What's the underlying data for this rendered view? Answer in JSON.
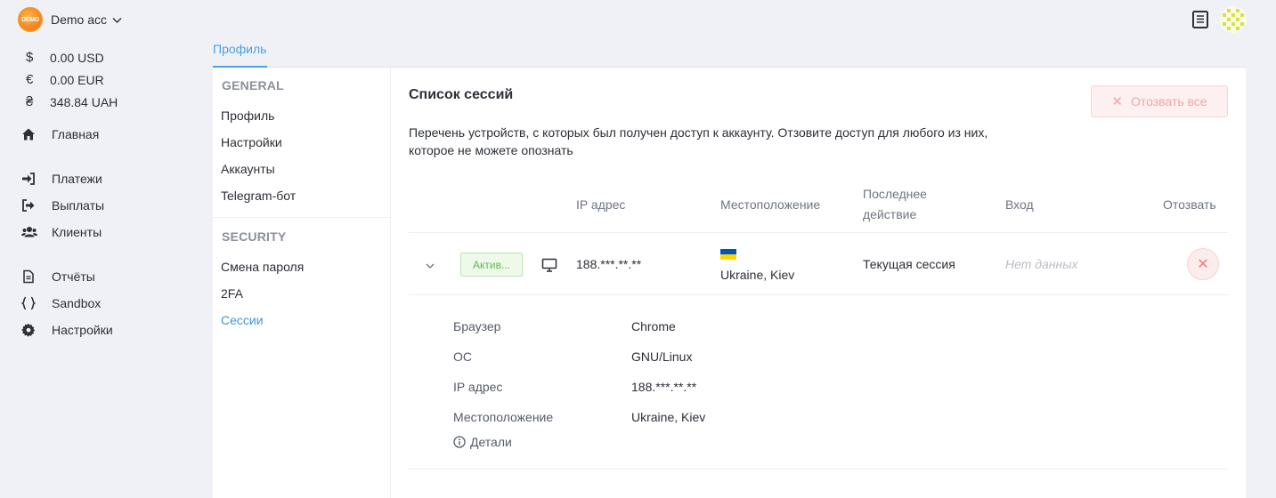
{
  "account": {
    "logo_text": "DEMO",
    "name": "Demo acc"
  },
  "balances": [
    {
      "symbol": "$",
      "amount": "0.00 USD"
    },
    {
      "symbol": "€",
      "amount": "0.00 EUR"
    },
    {
      "symbol": "₴",
      "amount": "348.84 UAH"
    }
  ],
  "nav": {
    "home": "Главная",
    "payments": "Платежи",
    "payouts": "Выплаты",
    "clients": "Клиенты",
    "reports": "Отчёты",
    "sandbox": "Sandbox",
    "settings": "Настройки"
  },
  "tabs": {
    "profile": "Профиль"
  },
  "subnav": {
    "general_title": "GENERAL",
    "profile": "Профиль",
    "settings": "Настройки",
    "accounts": "Аккаунты",
    "telegram": "Telegram-бот",
    "security_title": "SECURITY",
    "change_password": "Смена пароля",
    "twofa": "2FA",
    "sessions": "Сессии"
  },
  "sessions": {
    "title": "Список сессий",
    "revoke_all": "Отозвать все",
    "description_line1": "Перечень устройств, с которых был получен доступ к аккаунту. Отзовите доступ для любого из них,",
    "description_line2": "которое не можете опознать",
    "columns": {
      "ip": "IP адрес",
      "location": "Местоположение",
      "last_action_line1": "Последнее",
      "last_action_line2": "действие",
      "login": "Вход",
      "revoke": "Отозвать"
    },
    "row": {
      "status": "Актив...",
      "ip": "188.***.**.**",
      "location": "Ukraine, Kiev",
      "last_action": "Текущая сессия",
      "login": "Нет данных"
    },
    "details": {
      "browser_label": "Браузер",
      "browser_value": "Chrome",
      "os_label": "ОС",
      "os_value": "GNU/Linux",
      "ip_label": "IP адрес",
      "ip_value": "188.***.**.**",
      "location_label": "Местоположение",
      "location_value": "Ukraine, Kiev",
      "more_link": "Детали"
    }
  },
  "colors": {
    "accent": "#4a9fe0",
    "danger": "#ef7b7b",
    "success": "#5fbb4c"
  }
}
